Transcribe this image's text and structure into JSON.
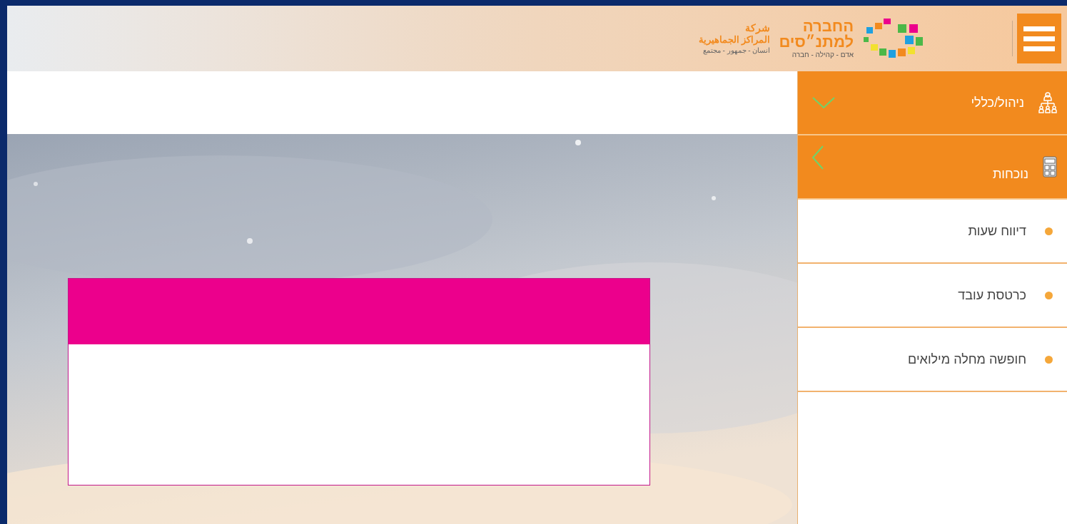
{
  "header": {
    "logo": {
      "hebrew_title": "החברה",
      "hebrew_subtitle": "למתנ״סים",
      "hebrew_tagline": "אדם - קהילה - חברה",
      "arabic_title": "شركة",
      "arabic_subtitle": "المراكز الجماهيرية",
      "arabic_tagline": "انسان - جمهور - مجتمع"
    }
  },
  "sidebar": {
    "items": [
      {
        "label": "ניהול/כללי",
        "expanded": false
      },
      {
        "label": "נוכחות",
        "expanded": true,
        "children": [
          {
            "label": "דיווח שעות"
          },
          {
            "label": "כרטסת עובד"
          },
          {
            "label": "חופשה מחלה מילואים"
          }
        ]
      }
    ]
  }
}
